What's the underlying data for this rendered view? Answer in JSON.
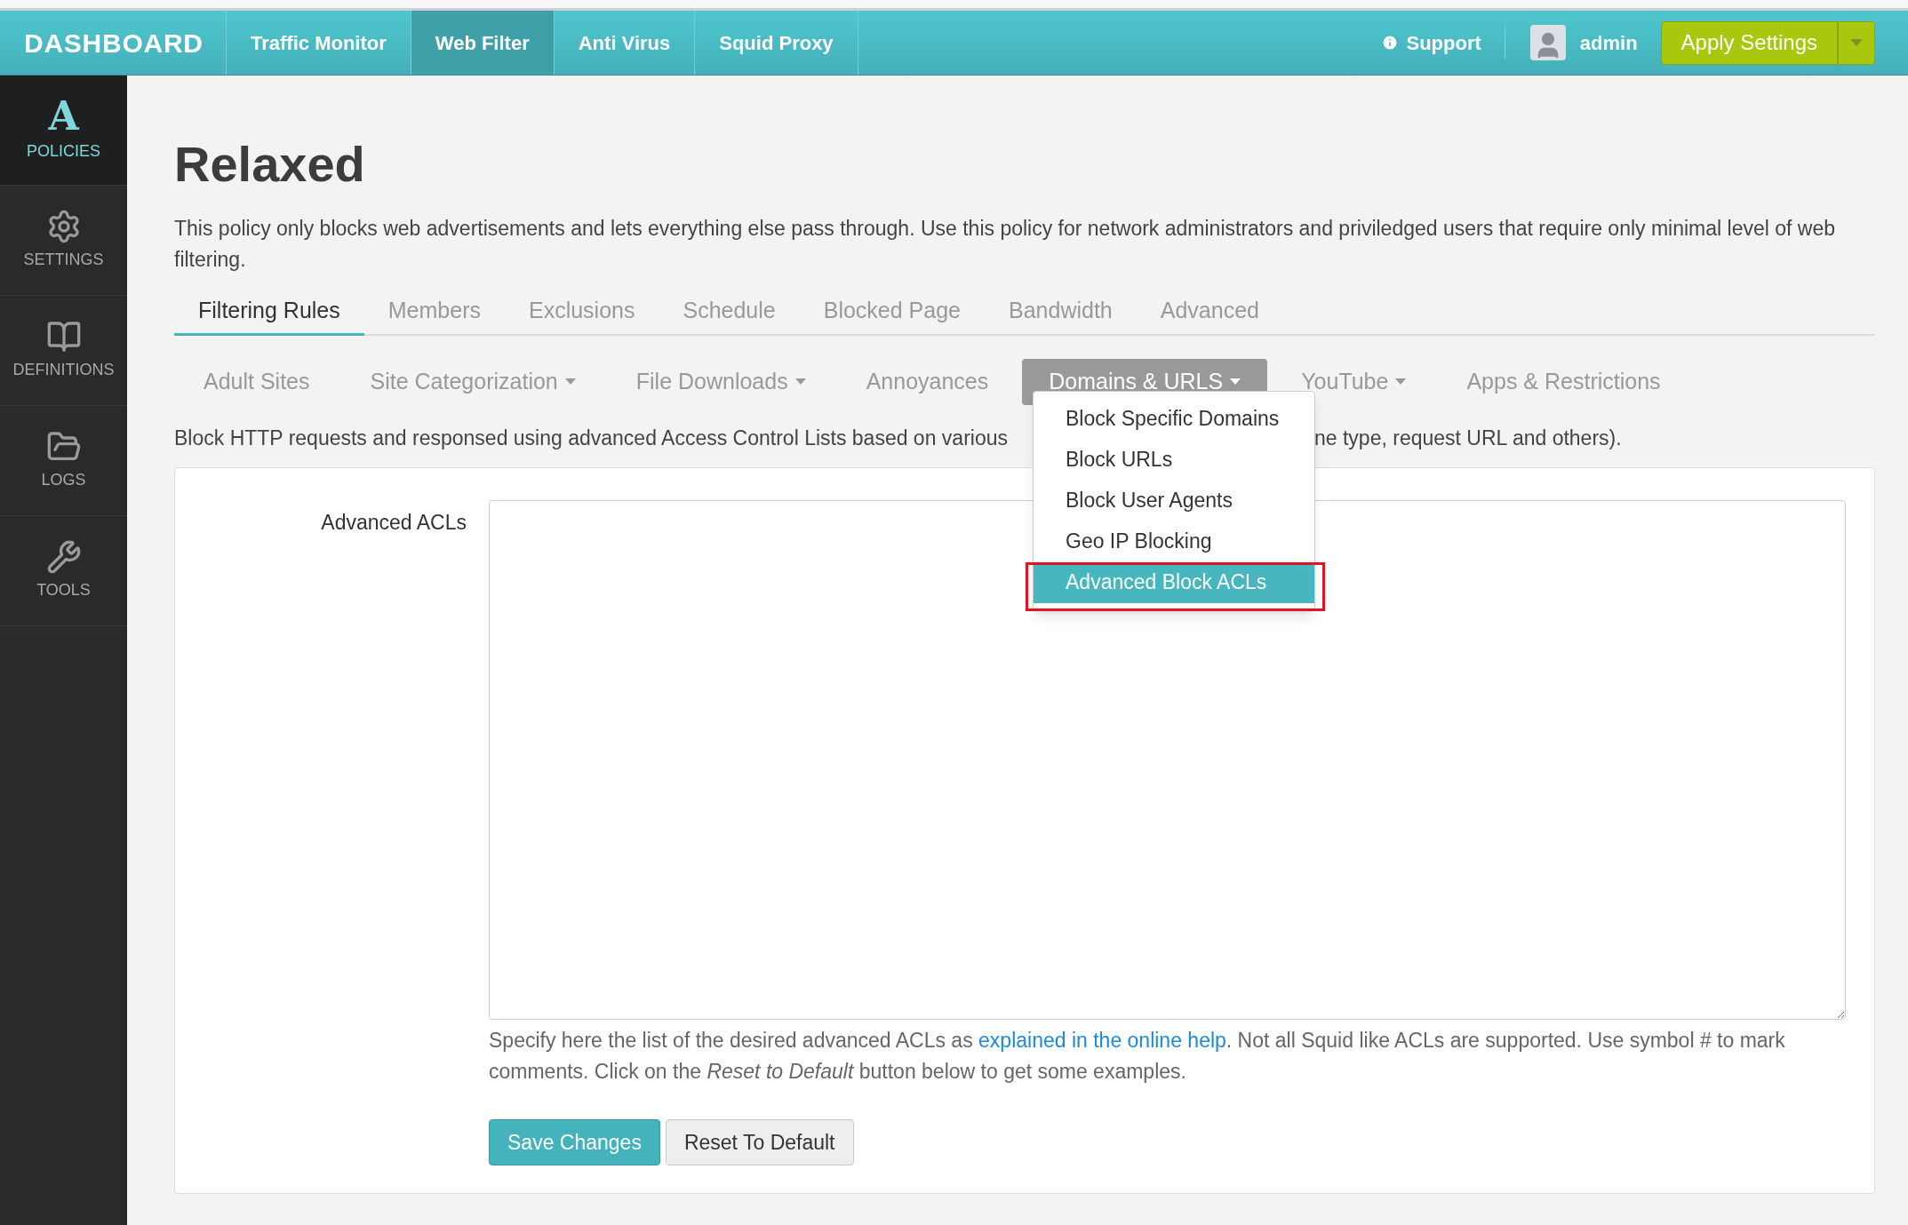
{
  "topbar": {
    "brand": "DASHBOARD",
    "nav": [
      {
        "label": "Traffic Monitor",
        "selected": false
      },
      {
        "label": "Web Filter",
        "selected": true
      },
      {
        "label": "Anti Virus",
        "selected": false
      },
      {
        "label": "Squid Proxy",
        "selected": false
      }
    ],
    "support": "Support",
    "user": "admin",
    "apply": "Apply Settings"
  },
  "sidebar": {
    "items": [
      {
        "label": "POLICIES",
        "glyph": "A",
        "selected": true
      },
      {
        "label": "SETTINGS",
        "selected": false
      },
      {
        "label": "DEFINITIONS",
        "selected": false
      },
      {
        "label": "LOGS",
        "selected": false
      },
      {
        "label": "TOOLS",
        "selected": false
      }
    ]
  },
  "title": "Relaxed",
  "description": "This policy only blocks web advertisements and lets everything else pass through. Use this policy for network administrators and priviledged users that require only minimal level of web filtering.",
  "tabs": [
    {
      "label": "Filtering Rules",
      "selected": true
    },
    {
      "label": "Members",
      "selected": false
    },
    {
      "label": "Exclusions",
      "selected": false
    },
    {
      "label": "Schedule",
      "selected": false
    },
    {
      "label": "Blocked Page",
      "selected": false
    },
    {
      "label": "Bandwidth",
      "selected": false
    },
    {
      "label": "Advanced",
      "selected": false
    }
  ],
  "subtabs": [
    {
      "label": "Adult Sites",
      "caret": false,
      "selected": false
    },
    {
      "label": "Site Categorization",
      "caret": true,
      "selected": false
    },
    {
      "label": "File Downloads",
      "caret": true,
      "selected": false
    },
    {
      "label": "Annoyances",
      "caret": false,
      "selected": false
    },
    {
      "label": "Domains & URLS",
      "caret": true,
      "selected": true
    },
    {
      "label": "YouTube",
      "caret": true,
      "selected": false
    },
    {
      "label": "Apps & Restrictions",
      "caret": false,
      "selected": false
    }
  ],
  "dropdown": [
    {
      "label": "Block Specific Domains",
      "selected": false,
      "annotated": false
    },
    {
      "label": "Block URLs",
      "selected": false,
      "annotated": false
    },
    {
      "label": "Block User Agents",
      "selected": false,
      "annotated": false
    },
    {
      "label": "Geo IP Blocking",
      "selected": false,
      "annotated": false
    },
    {
      "label": "Advanced Block ACLs",
      "selected": true,
      "annotated": true
    }
  ],
  "section_text_left": "Block HTTP requests and responsed using advanced Access Control Lists based on various",
  "section_text_right": "ne type, request URL and others).",
  "form": {
    "label": "Advanced ACLs",
    "help_before": "Specify here the list of the desired advanced ACLs as",
    "help_link": "explained in the online help",
    "help_after": ". Not all Squid like ACLs are supported. Use symbol # to mark comments. Click on the *Reset to Default* button below to get some examples.",
    "buttons": [
      {
        "label": "Save Changes",
        "kind": "primary"
      },
      {
        "label": "Reset To Default",
        "kind": "default"
      }
    ]
  }
}
